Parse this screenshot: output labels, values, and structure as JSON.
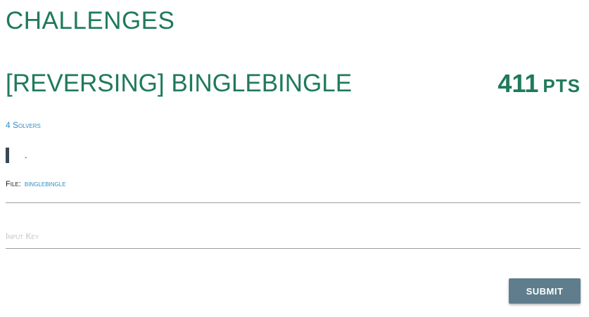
{
  "page": {
    "title": "CHALLENGES"
  },
  "challenge": {
    "name": "[REVERSING] BINGLEBINGLE",
    "points_value": "411",
    "points_unit": "PTS",
    "solvers_label": "4 Solvers",
    "description": ".",
    "file_label": "File:",
    "file_name": "binglebingle"
  },
  "form": {
    "key_placeholder": "Input Key",
    "submit_label": "SUBMIT"
  },
  "colors": {
    "heading_green": "#1f7a5c",
    "link_blue": "#2a8fc9",
    "button_slate": "#5f7d8c",
    "blockquote_bar": "#3a4750"
  }
}
